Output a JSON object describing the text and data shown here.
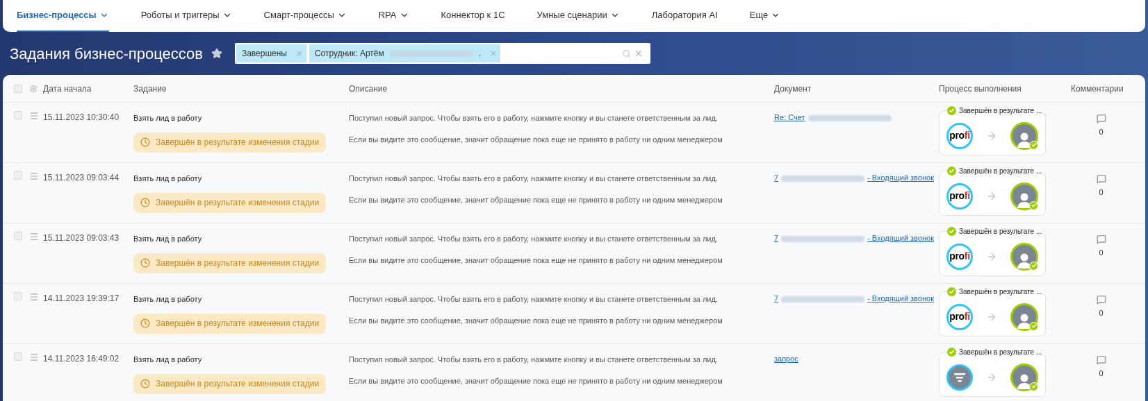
{
  "nav": [
    {
      "label": "Бизнес-процессы",
      "selected": true,
      "dropdown": true
    },
    {
      "label": "Роботы и триггеры",
      "selected": false,
      "dropdown": true
    },
    {
      "label": "Смарт-процессы",
      "selected": false,
      "dropdown": true
    },
    {
      "label": "RPA",
      "selected": false,
      "dropdown": true
    },
    {
      "label": "Коннектор к 1С",
      "selected": false,
      "dropdown": false
    },
    {
      "label": "Умные сценарии",
      "selected": false,
      "dropdown": true
    },
    {
      "label": "Лаборатория AI",
      "selected": false,
      "dropdown": false
    },
    {
      "label": "Еще",
      "selected": false,
      "dropdown": true
    }
  ],
  "page_title": "Задания бизнес-процессов",
  "filter": {
    "tags": [
      {
        "text_before_blur": "Завершены",
        "blurred": false
      },
      {
        "text_before_blur": "Сотрудник: Артём",
        "blurred": true,
        "text_after_blur": "."
      }
    ]
  },
  "table": {
    "all_checked": false,
    "columns": [
      "Дата начала",
      "Задание",
      "Описание",
      "Документ",
      "Процесс выполнения",
      "Комментарии"
    ],
    "rows": [
      {
        "checked": false,
        "date": "15.11.2023 10:30:40",
        "task": "Взять лид в работу",
        "status": "Завершён в результате изменения стадии",
        "description": [
          "Поступил новый запрос. Чтобы взять его в работу, нажмите кнопку и вы станете ответственным за лид.",
          "Если вы видите это сообщение, значит обращение пока еще не принято в работу ни одним менеджером"
        ],
        "document": {
          "text_before_blur": "Re: Счет",
          "blurred": true
        },
        "process": {
          "label": "Завершён в результате ...",
          "from": {
            "kind": "logo",
            "text": "profi"
          }
        },
        "comments": "0"
      },
      {
        "checked": false,
        "date": "15.11.2023 09:03:44",
        "task": "Взять лид в работу",
        "status": "Завершён в результате изменения стадии",
        "description": [
          "Поступил новый запрос. Чтобы взять его в работу, нажмите кнопку и вы станете ответственным за лид.",
          "Если вы видите это сообщение, значит обращение пока еще не принято в работу ни одним менеджером"
        ],
        "document": {
          "text_before_blur": "7",
          "blurred": true,
          "text_after_blur": "- Входящий звонок"
        },
        "process": {
          "label": "Завершён в результате ...",
          "from": {
            "kind": "logo",
            "text": "profi"
          }
        },
        "comments": "0"
      },
      {
        "checked": false,
        "date": "15.11.2023 09:03:43",
        "task": "Взять лид в работу",
        "status": "Завершён в результате изменения стадии",
        "description": [
          "Поступил новый запрос. Чтобы взять его в работу, нажмите кнопку и вы станете ответственным за лид.",
          "Если вы видите это сообщение, значит обращение пока еще не принято в работу ни одним менеджером"
        ],
        "document": {
          "text_before_blur": "7",
          "blurred": true,
          "text_after_blur": "- Входящий звонок"
        },
        "process": {
          "label": "Завершён в результате ...",
          "from": {
            "kind": "logo",
            "text": "profi"
          }
        },
        "comments": "0"
      },
      {
        "checked": false,
        "date": "14.11.2023 19:39:17",
        "task": "Взять лид в работу",
        "status": "Завершён в результате изменения стадии",
        "description": [
          "Поступил новый запрос. Чтобы взять его в работу, нажмите кнопку и вы станете ответственным за лид.",
          "Если вы видите это сообщение, значит обращение пока еще не принято в работу ни одним менеджером"
        ],
        "document": {
          "text_before_blur": "7",
          "blurred": true,
          "text_after_blur": "- Входящий звонок"
        },
        "process": {
          "label": "Завершён в результате ...",
          "from": {
            "kind": "logo",
            "text": "profi"
          }
        },
        "comments": "0"
      },
      {
        "checked": false,
        "date": "14.11.2023 16:49:02",
        "task": "Взять лид в работу",
        "status": "Завершён в результате изменения стадии",
        "description": [
          "Поступил новый запрос. Чтобы взять его в работу, нажмите кнопку и вы станете ответственным за лид.",
          "Если вы видите это сообщение, значит обращение пока еще не принято в работу ни одним менеджером"
        ],
        "document": {
          "text_before_blur": "запрос",
          "blurred": false
        },
        "process": {
          "label": "Завершён в результате ...",
          "from": {
            "kind": "funnel"
          }
        },
        "comments": "0"
      }
    ]
  }
}
